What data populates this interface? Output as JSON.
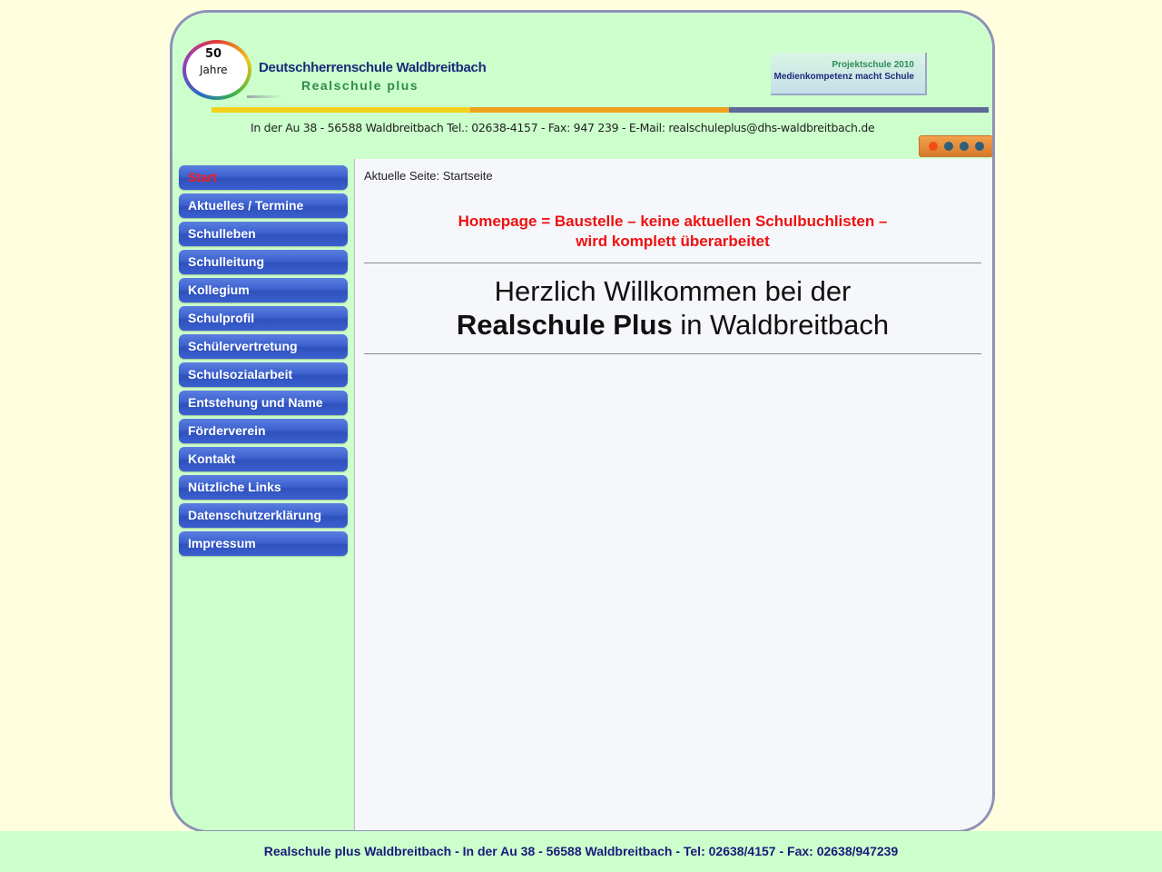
{
  "header": {
    "logo_number": "50",
    "logo_word": "Jahre",
    "school_name": "Deutschherrenschule Waldbreitbach",
    "school_type": "Realschule plus",
    "project_line1": "Projektschule 2010",
    "project_line2": "Medienkompetenz macht Schule",
    "address_line": "In der Au 38 -  56588 Waldbreitbach   Tel.: 02638-4157 -  Fax: 947 239  -  E-Mail: realschuleplus@dhs-waldbreitbach.de",
    "bar_colors": [
      "#f2d21a",
      "#f0a21e",
      "#5e6899"
    ]
  },
  "slider": {
    "active_index": 0,
    "count": 4
  },
  "nav": {
    "items": [
      {
        "label": "Start",
        "active": true
      },
      {
        "label": "Aktuelles / Termine"
      },
      {
        "label": "Schulleben"
      },
      {
        "label": "Schulleitung"
      },
      {
        "label": "Kollegium"
      },
      {
        "label": "Schulprofil"
      },
      {
        "label": "Schülervertretung"
      },
      {
        "label": "Schulsozialarbeit"
      },
      {
        "label": "Entstehung und Name"
      },
      {
        "label": "Förderverein"
      },
      {
        "label": "Kontakt"
      },
      {
        "label": "Nützliche Links"
      },
      {
        "label": "Datenschutzerklärung"
      },
      {
        "label": "Impressum"
      }
    ]
  },
  "content": {
    "breadcrumb": "Aktuelle Seite: Startseite",
    "notice_line1": "Homepage = Baustelle – keine aktuellen Schulbuchlisten –",
    "notice_line2": "wird komplett überarbeitet",
    "welcome_line1": "Herzlich Willkommen bei der",
    "welcome_bold": "Realschule Plus",
    "welcome_rest": " in Waldbreitbach"
  },
  "footer": {
    "text": "Realschule plus Waldbreitbach - In der Au 38 - 56588 Waldbreitbach - Tel: 02638/4157 - Fax: 02638/947239"
  }
}
